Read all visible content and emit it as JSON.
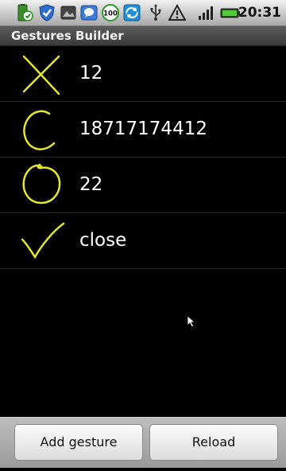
{
  "status_bar": {
    "time": "20:31",
    "icons": [
      "battery-charging-icon",
      "shield-check-icon",
      "image-icon",
      "chat-bubble-icon",
      "circle-100-icon",
      "sync-icon",
      "usb-icon",
      "warning-icon",
      "signal-bars-icon",
      "battery-icon"
    ],
    "badge_text": "100"
  },
  "app": {
    "title": "Gestures Builder"
  },
  "gestures": [
    {
      "name": "12",
      "icon": "x-gesture-icon"
    },
    {
      "name": "18717174412",
      "icon": "c-gesture-icon"
    },
    {
      "name": "22",
      "icon": "o-gesture-icon"
    },
    {
      "name": "close",
      "icon": "check-gesture-icon"
    }
  ],
  "buttons": {
    "add": "Add gesture",
    "reload": "Reload"
  },
  "colors": {
    "gesture_stroke": "#e6e62a",
    "background": "#000000"
  }
}
